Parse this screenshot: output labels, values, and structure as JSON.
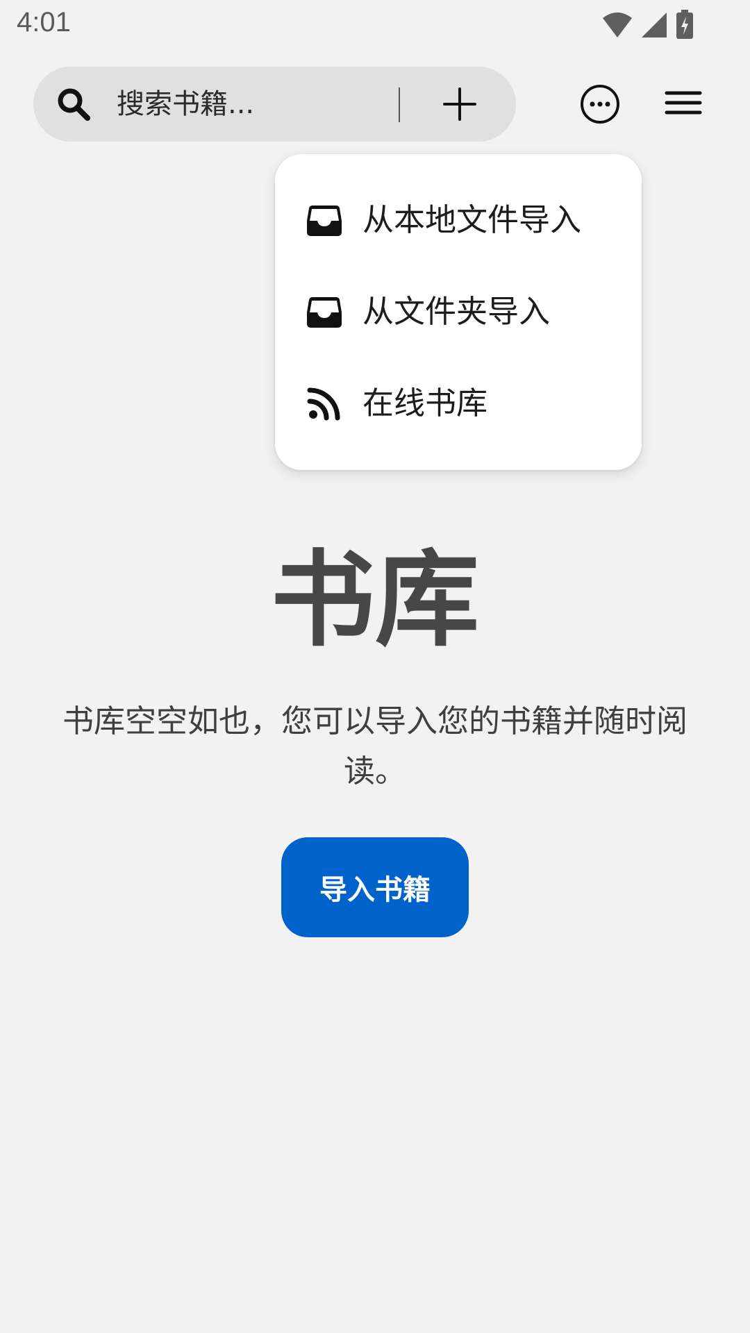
{
  "status_bar": {
    "time": "4:01"
  },
  "toolbar": {
    "search_placeholder": "搜索书籍...",
    "icons": {
      "search": "search-icon",
      "add": "plus-icon",
      "more": "more-options-icon",
      "menu": "hamburger-menu-icon"
    }
  },
  "dropdown": {
    "items": [
      {
        "label": "从本地文件导入",
        "icon": "inbox-tray-icon"
      },
      {
        "label": "从文件夹导入",
        "icon": "inbox-tray-icon"
      },
      {
        "label": "在线书库",
        "icon": "rss-feed-icon"
      }
    ]
  },
  "empty_state": {
    "title": "书库",
    "description": "书库空空如也，您可以导入您的书籍并随时阅读。",
    "button_label": "导入书籍"
  },
  "colors": {
    "background": "#f2f2f3",
    "accent": "#0063cc",
    "search_pill": "#e0e0e0"
  }
}
